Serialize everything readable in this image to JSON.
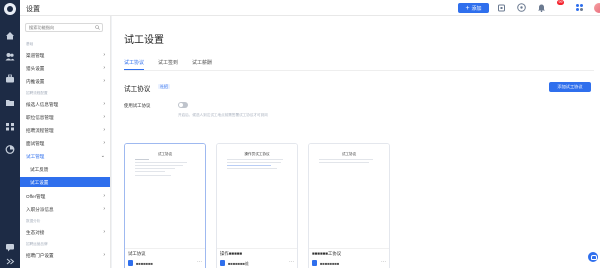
{
  "app": {
    "title": "设置"
  },
  "topbar": {
    "add_label": "添加",
    "notification_count": "99",
    "icons": [
      "home-icon",
      "help-icon",
      "bell-icon",
      "apps-icon"
    ]
  },
  "rail": {
    "icons": [
      "home-icon",
      "people-icon",
      "briefcase-icon",
      "folder-icon",
      "grid-icon",
      "user-icon",
      "chart-icon",
      "message-icon",
      "expand-icon"
    ]
  },
  "sidebar": {
    "search_placeholder": "搜索功能指向",
    "items": [
      {
        "type": "section",
        "label": "基础"
      },
      {
        "type": "item",
        "label": "渠道管理",
        "chevron": "›"
      },
      {
        "type": "item",
        "label": "猎头设置",
        "chevron": "›"
      },
      {
        "type": "item",
        "label": "内推设置",
        "chevron": "›"
      },
      {
        "type": "section",
        "label": "招聘流程配置"
      },
      {
        "type": "item",
        "label": "候选人信息管理",
        "chevron": "›"
      },
      {
        "type": "item",
        "label": "职位信息管理",
        "chevron": "›"
      },
      {
        "type": "item",
        "label": "招聘流程管理",
        "chevron": "›"
      },
      {
        "type": "item",
        "label": "面试管理",
        "chevron": "›"
      },
      {
        "type": "item",
        "label": "试工管理",
        "chevron": "⌄",
        "state": "open"
      },
      {
        "type": "sub",
        "label": "试工反馈"
      },
      {
        "type": "sub",
        "label": "试工设置",
        "state": "active"
      },
      {
        "type": "item",
        "label": "Offer管理",
        "chevron": "›"
      },
      {
        "type": "item",
        "label": "入职分派信息",
        "chevron": "›"
      },
      {
        "type": "section",
        "label": "数据分析"
      },
      {
        "type": "item",
        "label": "生态对接",
        "chevron": "›"
      },
      {
        "type": "section",
        "label": "招聘运营品牌"
      },
      {
        "type": "item",
        "label": "招聘门户设置",
        "chevron": "›"
      }
    ]
  },
  "main": {
    "title": "试工设置",
    "tabs": [
      {
        "label": "试工协议",
        "active": true
      },
      {
        "label": "试工签到",
        "active": false
      },
      {
        "label": "试工薪酬",
        "active": false
      }
    ],
    "section_title": "试工协议",
    "section_tag": "社招",
    "add_button": "添加试工协议",
    "switch": {
      "label": "使用试工协议",
      "on": false,
      "hint": "开启后，候选人到达试工地点前需签署试工协议才可到岗"
    },
    "cards": [
      {
        "preview_title": "试工协议",
        "name": "试工协议",
        "owner": "■■■■■■■",
        "selected": true
      },
      {
        "preview_title": "操作员试工协议",
        "name": "操作■■■■■",
        "owner": "■■■■■■■维",
        "selected": false
      },
      {
        "preview_title": "试工协议",
        "name": "■■■■■■工协议",
        "owner": "■■■■■■■■",
        "selected": false
      }
    ],
    "more_glyph": "···"
  },
  "colors": {
    "accent": "#2f6fed",
    "rail": "#1d2b45"
  }
}
